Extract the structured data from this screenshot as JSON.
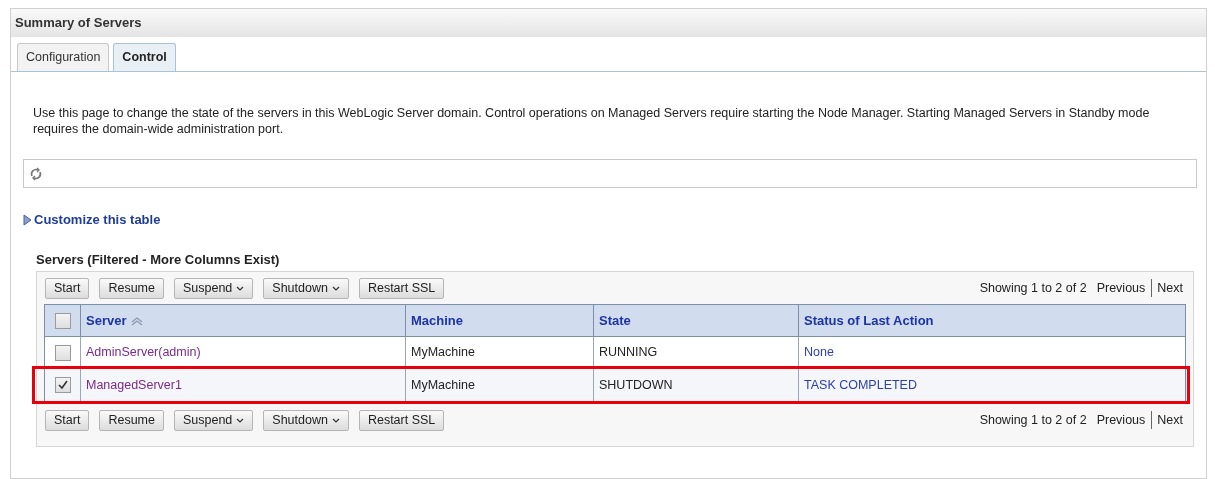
{
  "title": "Summary of Servers",
  "tabs": [
    {
      "label": "Configuration",
      "selected": false
    },
    {
      "label": "Control",
      "selected": true
    }
  ],
  "description": "Use this page to change the state of the servers in this WebLogic Server domain. Control operations on Managed Servers require starting the Node Manager. Starting Managed Servers in Standby mode requires the domain-wide administration port.",
  "customize_link": "Customize this table",
  "table_title": "Servers (Filtered - More Columns Exist)",
  "toolbar_top": {
    "buttons": [
      {
        "label": "Start",
        "kind": "plain"
      },
      {
        "label": "Resume",
        "kind": "plain"
      },
      {
        "label": "Suspend",
        "kind": "menu"
      },
      {
        "label": "Shutdown",
        "kind": "menu"
      },
      {
        "label": "Restart SSL",
        "kind": "plain"
      }
    ],
    "paging": "Showing 1 to 2 of 2",
    "previous": "Previous",
    "next": "Next"
  },
  "table": {
    "select_all_checked": false,
    "columns": [
      {
        "label": "Server",
        "sorted": true
      },
      {
        "label": "Machine",
        "sorted": false
      },
      {
        "label": "State",
        "sorted": false
      },
      {
        "label": "Status of Last Action",
        "sorted": false
      }
    ],
    "rows": [
      {
        "checked": false,
        "highlighted": false,
        "server": "AdminServer(admin)",
        "machine": "MyMachine",
        "state": "RUNNING",
        "status": "None"
      },
      {
        "checked": true,
        "highlighted": true,
        "server": "ManagedServer1",
        "machine": "MyMachine",
        "state": "SHUTDOWN",
        "status": "TASK COMPLETED"
      }
    ]
  },
  "toolbar_bottom": {
    "buttons": [
      {
        "label": "Start",
        "kind": "plain"
      },
      {
        "label": "Resume",
        "kind": "plain"
      },
      {
        "label": "Suspend",
        "kind": "menu"
      },
      {
        "label": "Shutdown",
        "kind": "menu"
      },
      {
        "label": "Restart SSL",
        "kind": "plain"
      }
    ],
    "paging": "Showing 1 to 2 of 2",
    "previous": "Previous",
    "next": "Next"
  }
}
